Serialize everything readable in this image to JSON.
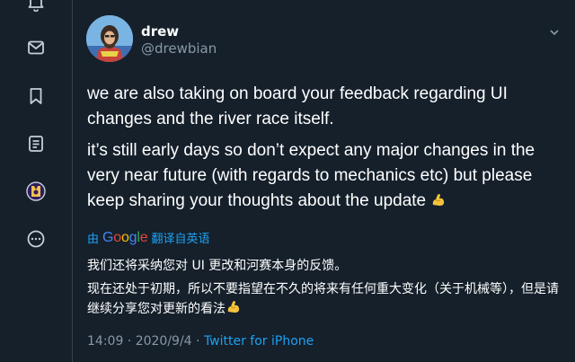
{
  "sidebar": {
    "items": [
      {
        "icon": "bell-icon"
      },
      {
        "icon": "mail-icon"
      },
      {
        "icon": "bookmark-icon"
      },
      {
        "icon": "lists-icon"
      },
      {
        "icon": "profile-avatar-icon"
      },
      {
        "icon": "more-icon"
      }
    ]
  },
  "tweet": {
    "display_name": "drew",
    "handle": "@drewbian",
    "paragraphs": [
      "we are also taking on board your feedback regarding UI changes and the river race itself.",
      "it’s still early days so don’t expect any major changes in the very near future (with regards to mechanics etc) but please keep sharing your thoughts about the update"
    ],
    "emoji": "flexed-biceps-emoji",
    "translation": {
      "prefix": "由",
      "provider": "Google",
      "suffix": "翻译自英语",
      "lines": [
        "我们还将采纳您对 UI 更改和河赛本身的反馈。",
        "现在还处于初期，所以不要指望在不久的将来有任何重大变化（关于机械等），但是请继续分享您对更新的看法"
      ]
    },
    "timestamp": "14:09 · 2020/9/4 · ",
    "source": "Twitter for iPhone"
  },
  "colors": {
    "background": "#15202b",
    "accent": "#1da1f2",
    "secondary_text": "#8899a6",
    "divider": "#38444d"
  }
}
